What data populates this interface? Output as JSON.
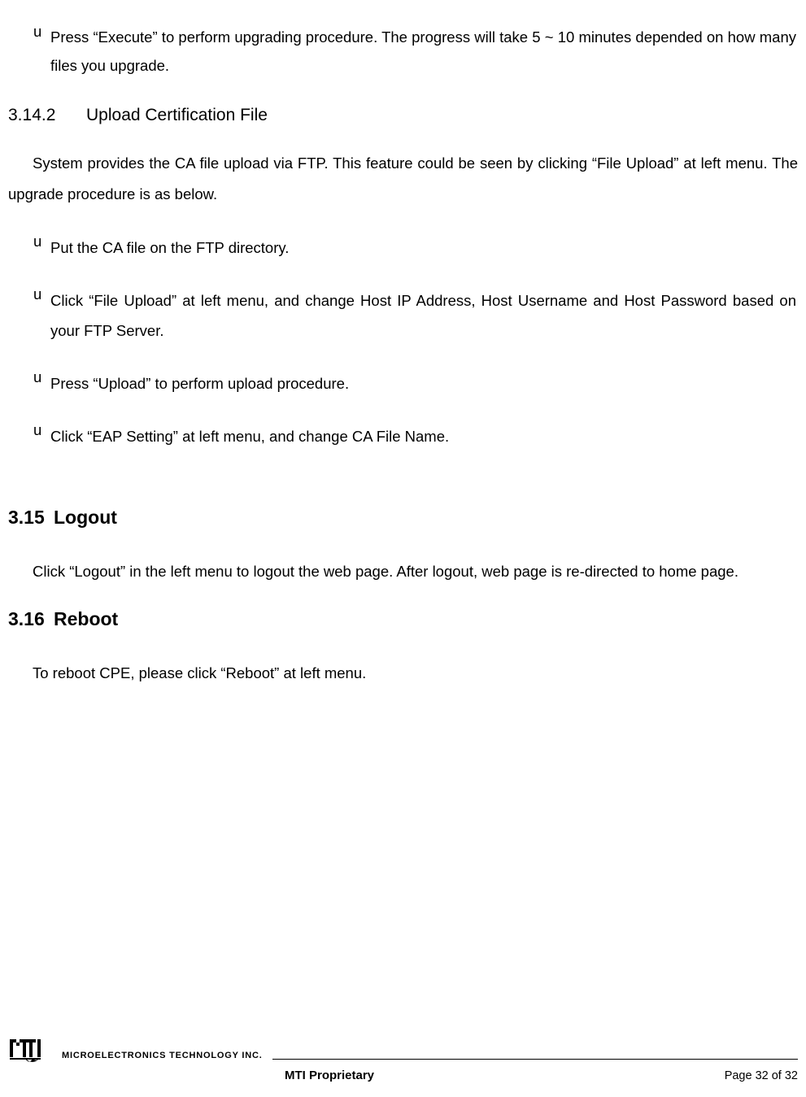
{
  "bullets_top": [
    "Press “Execute” to perform upgrading procedure. The progress will take 5 ~ 10 minutes depended on how many files you upgrade."
  ],
  "section_3_14_2": {
    "number": "3.14.2",
    "title": "Upload Certification File",
    "para": "System provides the CA file upload via FTP. This feature could be seen by clicking “File Upload” at left menu. The upgrade procedure is as below.",
    "bullets": [
      "Put the CA file on the FTP directory.",
      "Click “File Upload” at left menu, and change Host IP Address, Host Username and Host Password based on your FTP Server.",
      "Press “Upload” to perform upload procedure.",
      "Click “EAP Setting” at left menu, and change CA File Name."
    ]
  },
  "section_3_15": {
    "number": "3.15",
    "title": "Logout",
    "para": "Click “Logout” in the left menu to logout the web page. After logout, web page is re-directed to home page."
  },
  "section_3_16": {
    "number": "3.16",
    "title": "Reboot",
    "para": "To reboot CPE, please click “Reboot” at left menu."
  },
  "bullet_char": "u",
  "footer": {
    "company": "MICROELECTRONICS TECHNOLOGY INC.",
    "proprietary": "MTI Proprietary",
    "page": "Page 32 of 32"
  }
}
